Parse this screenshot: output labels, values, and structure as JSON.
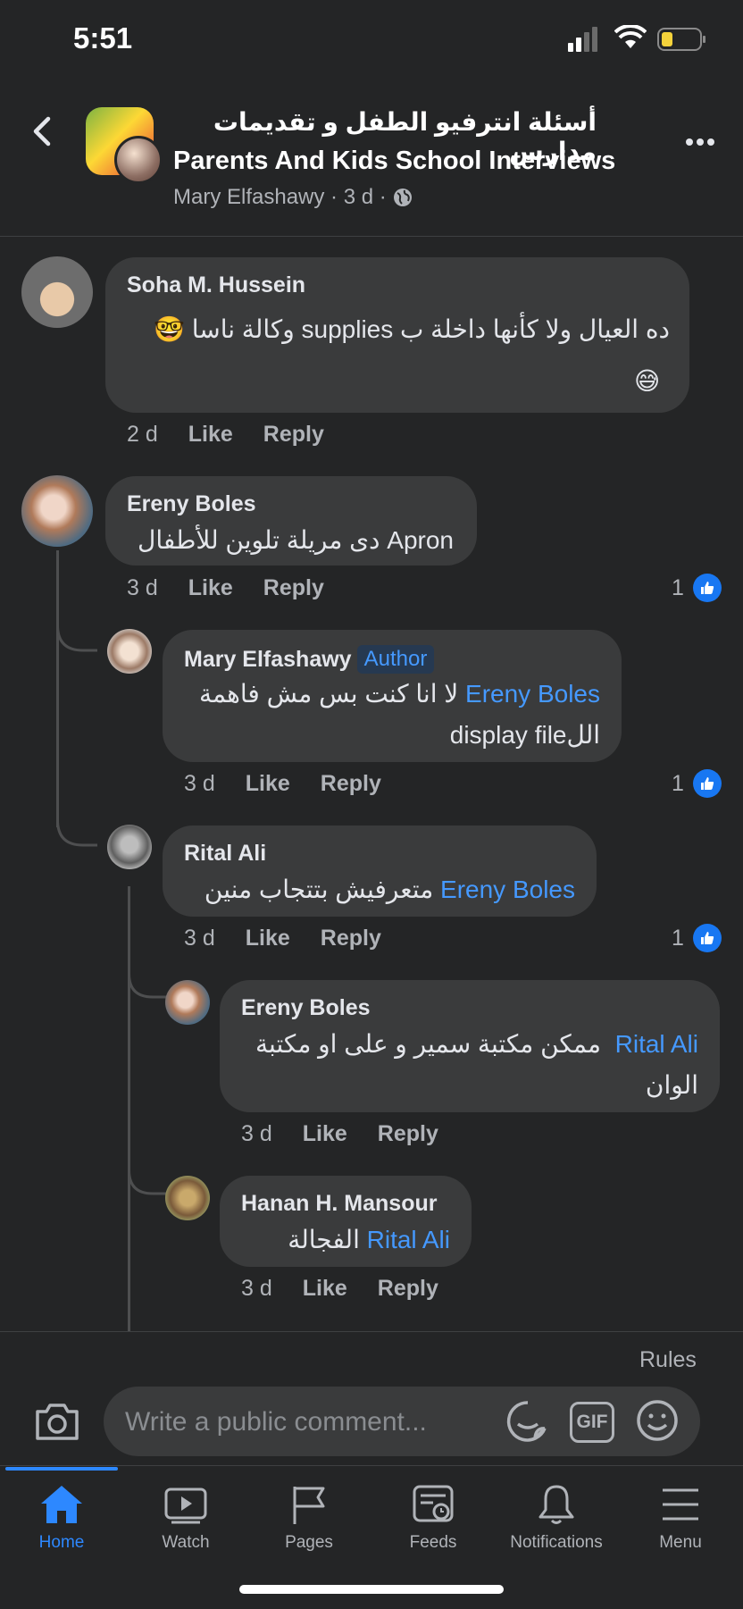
{
  "status_bar": {
    "time": "5:51"
  },
  "header": {
    "group_title_ar": "أسئلة انترفيو الطفل و تقديمات مدارس",
    "group_title_en": "Parents And Kids School Interviews",
    "meta": "Mary Elfashawy · 3 d ·"
  },
  "comments": [
    {
      "author": "Soha M. Hussein",
      "text_ar": "ده العيال ولا كأنها داخلة ب supplies وكالة ناسا 🤓",
      "text_emoji": "😅",
      "time": "2 d",
      "like": "Like",
      "reply": "Reply"
    },
    {
      "author": "Ereny Boles",
      "text": "Apron دى مريلة تلوين للأطفال",
      "time": "3 d",
      "like": "Like",
      "reply": "Reply",
      "likes": "1"
    },
    {
      "author": "Mary Elfashawy",
      "badge": "Author",
      "mention": "Ereny Boles",
      "text_line1": "لا انا كنت بس مش فاهمة",
      "text_line2": "display fileالل",
      "time": "3 d",
      "like": "Like",
      "reply": "Reply",
      "likes": "1"
    },
    {
      "author": "Rital Ali",
      "mention": "Ereny Boles",
      "text": "متعرفيش بتتجاب منين",
      "time": "3 d",
      "like": "Like",
      "reply": "Reply",
      "likes": "1"
    },
    {
      "author": "Ereny Boles",
      "mention": "Rital Ali",
      "text_line1": "ممكن مكتبة سمير و على او مكتبة",
      "text_line2": "الوان",
      "time": "3 d",
      "like": "Like",
      "reply": "Reply"
    },
    {
      "author": "Hanan H. Mansour",
      "mention": "Rital Ali",
      "text": "الفجالة",
      "time": "3 d",
      "like": "Like",
      "reply": "Reply"
    }
  ],
  "composer": {
    "rules": "Rules",
    "placeholder": "Write a public comment...",
    "gif": "GIF"
  },
  "tabs": [
    {
      "label": "Home",
      "icon": "home-icon"
    },
    {
      "label": "Watch",
      "icon": "watch-icon"
    },
    {
      "label": "Pages",
      "icon": "flag-icon"
    },
    {
      "label": "Feeds",
      "icon": "feeds-icon"
    },
    {
      "label": "Notifications",
      "icon": "bell-icon"
    },
    {
      "label": "Menu",
      "icon": "menu-icon"
    }
  ],
  "colors": {
    "background": "#242526",
    "bubble": "#3a3b3c",
    "accent": "#2d88ff",
    "mention": "#4599ff"
  }
}
